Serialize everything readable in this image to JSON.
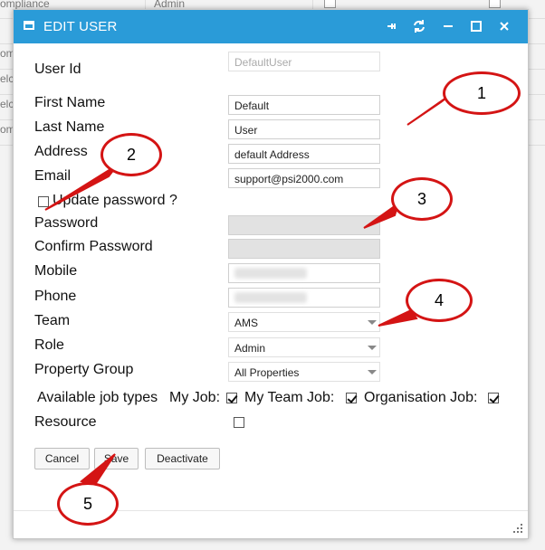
{
  "background": {
    "rows": [
      "ompliance",
      "",
      "omp",
      "elco",
      "elco",
      "omp"
    ],
    "col_text": "Admin"
  },
  "modal": {
    "title": "EDIT USER",
    "controls": [
      "pin-icon",
      "refresh-icon",
      "minimize-icon",
      "maximize-icon",
      "close-icon"
    ]
  },
  "form": {
    "user_id": {
      "label": "User Id",
      "value": "DefaultUser"
    },
    "first_name": {
      "label": "First Name",
      "value": "Default"
    },
    "last_name": {
      "label": "Last Name",
      "value": "User"
    },
    "address": {
      "label": "Address",
      "value": "default Address"
    },
    "email": {
      "label": "Email",
      "value": "support@psi2000.com"
    },
    "update_password": {
      "label": "Update password ?",
      "checked": false
    },
    "password": {
      "label": "Password",
      "value": ""
    },
    "confirm_password": {
      "label": "Confirm Password",
      "value": ""
    },
    "mobile": {
      "label": "Mobile",
      "value": ""
    },
    "phone": {
      "label": "Phone",
      "value": ""
    },
    "team": {
      "label": "Team",
      "value": "AMS"
    },
    "role": {
      "label": "Role",
      "value": "Admin"
    },
    "property_group": {
      "label": "Property Group",
      "value": "All Properties"
    },
    "job_types": {
      "label": "Available job types",
      "my_job": {
        "label": "My Job:",
        "checked": true
      },
      "my_team_job": {
        "label": "My Team Job:",
        "checked": true
      },
      "organisation_job": {
        "label": "Organisation Job:",
        "checked": true
      }
    },
    "resource": {
      "label": "Resource",
      "checked": false
    }
  },
  "buttons": {
    "cancel": "Cancel",
    "save": "Save",
    "deactivate": "Deactivate"
  },
  "callouts": [
    "1",
    "2",
    "3",
    "4",
    "5"
  ],
  "colors": {
    "titlebar": "#2a9bd8",
    "callout": "#d41414"
  }
}
